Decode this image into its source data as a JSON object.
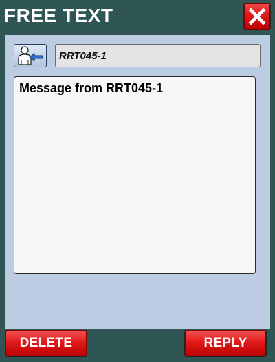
{
  "window": {
    "title": "FREE TEXT",
    "close_icon": "close-x-icon"
  },
  "header": {
    "user_icon": "user-arrow-icon",
    "from_value": "RRT045-1"
  },
  "message": {
    "body": "Message from RRT045-1"
  },
  "footer": {
    "delete_label": "DELETE",
    "reply_label": "REPLY"
  },
  "colors": {
    "background": "#2f5555",
    "panel": "#bccce3",
    "button_red": "#e21a1a",
    "field_gray": "#e4e4e4"
  }
}
